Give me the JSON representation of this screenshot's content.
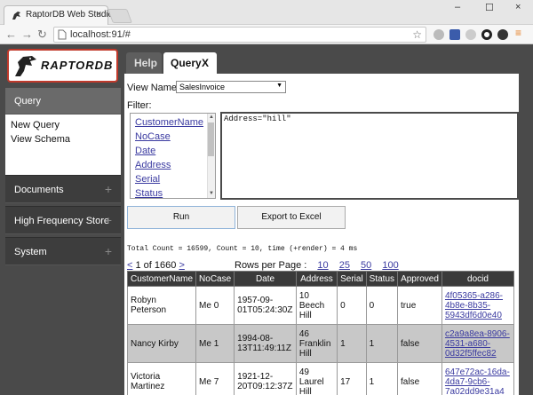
{
  "browser": {
    "tab_title": "RaptorDB Web Studio",
    "tab_close": "×",
    "url": "localhost:91/#",
    "window_controls": [
      "–",
      "☐",
      "×"
    ]
  },
  "logo": {
    "text": "RAPTORDB"
  },
  "sidebar": {
    "active": "Query",
    "sub_items": [
      "New Query",
      "View Schema"
    ],
    "sections": [
      {
        "label": "Documents",
        "expand": "+"
      },
      {
        "label": "High Frequency Store",
        "expand": "+"
      },
      {
        "label": "System",
        "expand": "+"
      }
    ]
  },
  "tabs": {
    "help": "Help",
    "query": "Query",
    "query_close": "X"
  },
  "query_panel": {
    "view_label": "View Name :",
    "view_value": "SalesInvoice",
    "filter_label": "Filter:",
    "fields": [
      "CustomerName",
      "NoCase",
      "Date",
      "Address",
      "Serial",
      "Status"
    ],
    "filter_text": "Address=\"hill\"",
    "run_label": "Run",
    "export_label": "Export to Excel",
    "count_text": "Total Count = 16599, Count = 10, time (+render) = 4 ms",
    "pager": {
      "prev": "<",
      "text": "1 of 1660",
      "next": ">"
    },
    "rows_label": "Rows per Page :",
    "rows_options": [
      "10",
      "25",
      "50",
      "100"
    ]
  },
  "table": {
    "columns": [
      "CustomerName",
      "NoCase",
      "Date",
      "Address",
      "Serial",
      "Status",
      "Approved",
      "docid"
    ],
    "rows": [
      [
        "Robyn Peterson",
        "Me 0",
        "1957-09-01T05:24:30Z",
        "10 Beech Hill",
        "0",
        "0",
        "true",
        "4f05365-a286-4b8e-8b35-5943df6d0e40"
      ],
      [
        "Nancy Kirby",
        "Me 1",
        "1994-08-13T11:49:11Z",
        "46 Franklin Hill",
        "1",
        "1",
        "false",
        "c2a9a8ea-8906-4531-a680-0d32f5ffec82"
      ],
      [
        "Victoria Martinez",
        "Me 7",
        "1921-12-20T09:12:37Z",
        "49 Laurel Hill",
        "17",
        "1",
        "false",
        "647e72ac-16da-4da7-9cb6-7a02dd9e31a4"
      ]
    ]
  }
}
